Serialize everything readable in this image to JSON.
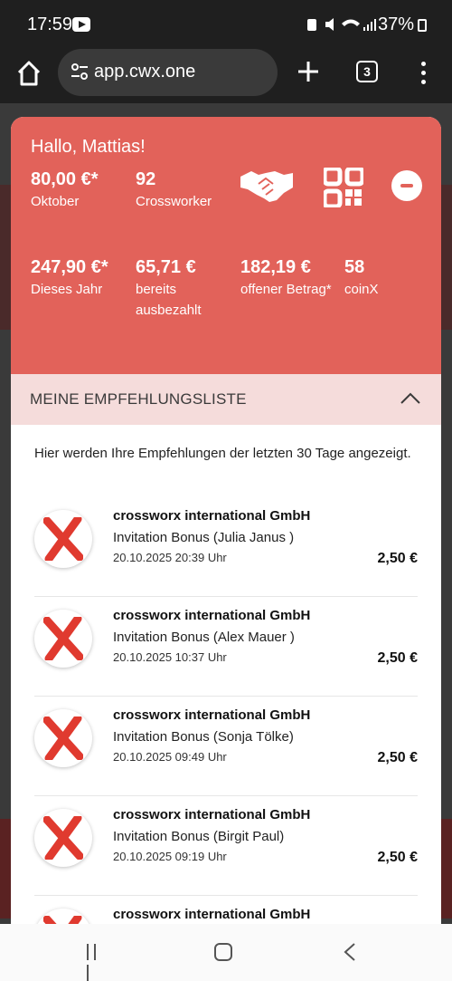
{
  "status_bar": {
    "time": "17:59",
    "battery": "37%",
    "icons": [
      "youtube-icon",
      "battery-saver-icon",
      "mute-icon",
      "wifi-icon",
      "signal-icon",
      "battery-icon"
    ]
  },
  "browser": {
    "url": "app.cwx.one",
    "tab_count": "3"
  },
  "hero": {
    "greeting": "Hallo, Mattias!",
    "stats_row1": [
      {
        "value": "80,00 €*",
        "label": "Oktober"
      },
      {
        "value": "92",
        "label": "Crossworker"
      }
    ],
    "stats_row2": [
      {
        "value": "247,90 €*",
        "label": "Dieses Jahr"
      },
      {
        "value": "65,71 €",
        "label": "bereits ausbezahlt"
      },
      {
        "value": "182,19 €",
        "label": "offener Betrag*"
      },
      {
        "value": "58",
        "label": "coinX"
      }
    ],
    "accent_color": "#e2625a"
  },
  "section": {
    "title": "MEINE EMPFEHLUNGSLISTE",
    "info": "Hier werden Ihre Empfehlungen der letzten 30 Tage angezeigt."
  },
  "referrals": [
    {
      "company": "crossworx international GmbH",
      "description": "Invitation Bonus (Julia Janus )",
      "date": "20.10.2025 20:39 Uhr",
      "amount": "2,50 €"
    },
    {
      "company": "crossworx international GmbH",
      "description": "Invitation Bonus (Alex Mauer )",
      "date": "20.10.2025 10:37 Uhr",
      "amount": "2,50 €"
    },
    {
      "company": "crossworx international GmbH",
      "description": "Invitation Bonus (Sonja Tölke)",
      "date": "20.10.2025 09:49 Uhr",
      "amount": "2,50 €"
    },
    {
      "company": "crossworx international GmbH",
      "description": "Invitation Bonus (Birgit Paul)",
      "date": "20.10.2025 09:19 Uhr",
      "amount": "2,50 €"
    },
    {
      "company": "crossworx international GmbH",
      "description": "",
      "date": "",
      "amount": ""
    }
  ]
}
